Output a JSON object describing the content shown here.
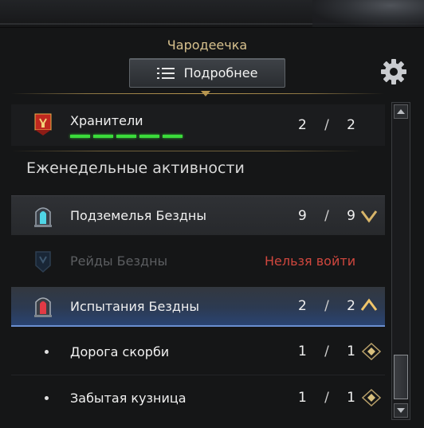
{
  "header": {
    "class_name": "Чародеечка",
    "details_button_label": "Подробнее",
    "icons": {
      "details": "list-icon",
      "settings": "gear-icon"
    }
  },
  "guardians": {
    "label": "Хранители",
    "current": "2",
    "separator": "/",
    "total": "2",
    "progress_segments_filled": 5,
    "progress_segments_total": 5,
    "progress_color": "#3bdb3b",
    "icon": "banner-icon"
  },
  "weekly": {
    "title": "Еженедельные активности",
    "rows": [
      {
        "label": "Подземелья Бездны",
        "current": "9",
        "separator": "/",
        "total": "9",
        "expander": "chevron-down-icon",
        "icon": "abyss-portal-icon"
      },
      {
        "label": "Рейды Бездны",
        "status": "Нельзя войти",
        "status_color": "#d0473e",
        "icon": "abyss-raid-icon"
      },
      {
        "label": "Испытания Бездны",
        "current": "2",
        "separator": "/",
        "total": "2",
        "expander": "chevron-up-icon",
        "icon": "abyss-trial-icon"
      }
    ],
    "sub_items": [
      {
        "label": "Дорога скорби",
        "current": "1",
        "separator": "/",
        "total": "1",
        "icon": "diamond-marker-icon"
      },
      {
        "label": "Забытая кузница",
        "current": "1",
        "separator": "/",
        "total": "1",
        "icon": "diamond-marker-icon"
      }
    ]
  },
  "colors": {
    "accent_gold": "#d8c28e",
    "selected_blue": "#2a4472",
    "progress_green": "#3bdb3b",
    "blocked_red": "#d0473e"
  }
}
